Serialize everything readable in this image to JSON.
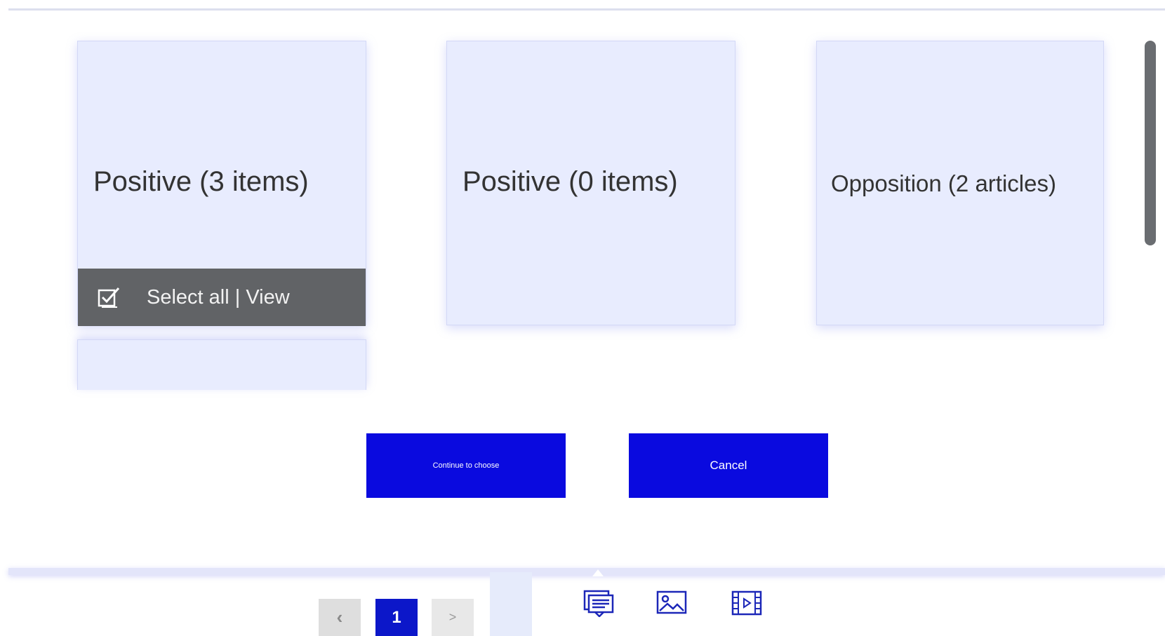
{
  "cards": [
    {
      "title": "Positive (3 items)",
      "select_label": "Select all | View"
    },
    {
      "title": "Positive (0 items)"
    },
    {
      "title": "Opposition (2 articles)"
    }
  ],
  "buttons": {
    "continue_label": "Continue to choose",
    "cancel_label": "Cancel"
  },
  "pagination": {
    "prev_label": "‹",
    "current_page": "1",
    "next_label": ">"
  },
  "media_tabs": [
    "text-icon",
    "image-icon",
    "video-icon"
  ],
  "colors": {
    "card_bg": "#e8ecfe",
    "primary_button": "#0a0adf",
    "select_bar": "#616366",
    "active_page": "#0c17c9"
  }
}
